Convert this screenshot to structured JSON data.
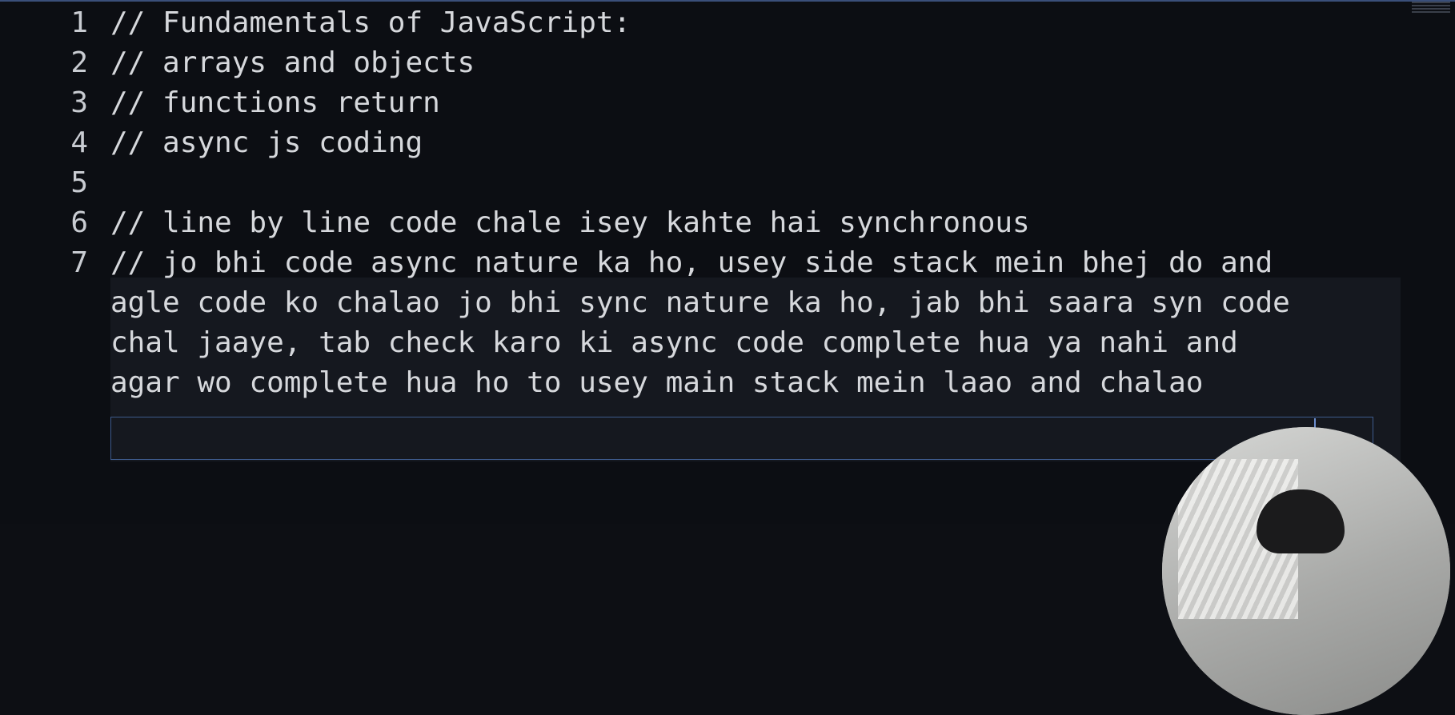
{
  "editor": {
    "line_numbers": [
      "1",
      "2",
      "3",
      "4",
      "5",
      "6",
      "7"
    ],
    "lines": [
      "// Fundamentals of JavaScript:",
      "// arrays and objects",
      "// functions return",
      "// async js coding",
      "",
      "// line by line code chale isey kahte hai synchronous",
      "// jo bhi code async nature ka ho, usey side stack mein bhej do and",
      "agle code ko chalao jo bhi sync nature ka ho, jab bhi saara syn code",
      "chal jaaye, tab check karo ki async code complete hua ya nahi and",
      "agar wo complete hua ho to usey main stack mein laao and chalao"
    ]
  },
  "colors": {
    "background": "#0c0e13",
    "text": "#d6d8dc",
    "line_number": "#c9ccd2",
    "active_block": "#15181f",
    "selection_border": "#3d5a8c"
  }
}
